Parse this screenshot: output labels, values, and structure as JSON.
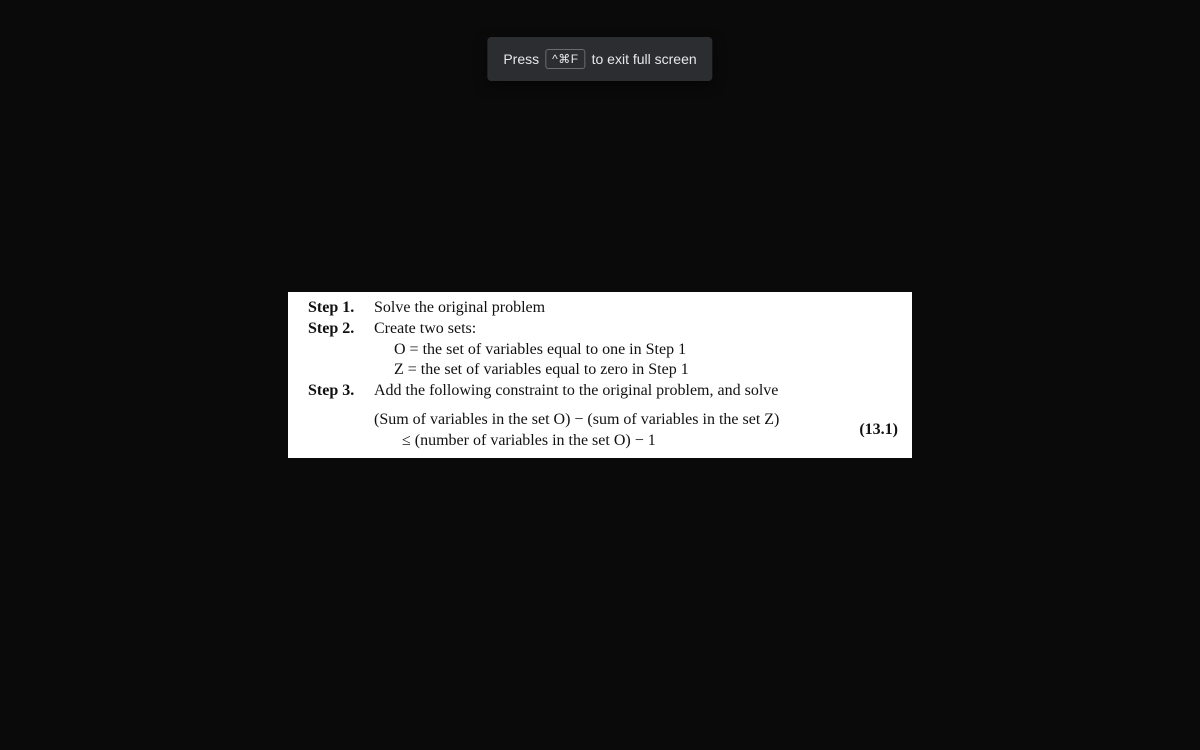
{
  "hint": {
    "press": "Press",
    "key": "^⌘F",
    "rest": "to exit full screen"
  },
  "doc": {
    "step1_label": "Step 1.",
    "step1_text": "Solve the original problem",
    "step2_label": "Step 2.",
    "step2_text": "Create two sets:",
    "step2_o": "O = the set of variables equal to one in Step 1",
    "step2_z": "Z = the set of variables equal to zero in Step 1",
    "step3_label": "Step 3.",
    "step3_text": "Add the following constraint to the original problem, and solve",
    "eq_line1": "(Sum of variables in the set O) − (sum of variables in the set Z)",
    "eq_line2": "≤ (number of variables in the set O) − 1",
    "eq_num": "(13.1)"
  }
}
